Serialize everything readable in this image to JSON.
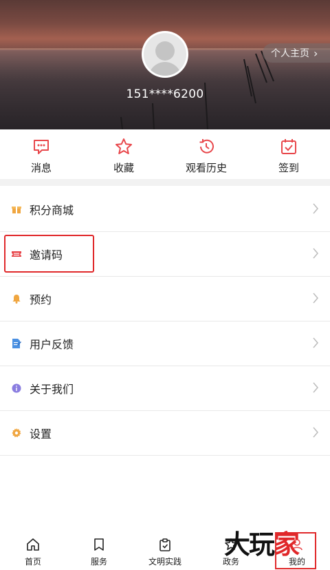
{
  "header": {
    "phone": "151****6200",
    "home_link": "个人主页"
  },
  "quick_actions": [
    {
      "label": "消息",
      "icon": "message-icon"
    },
    {
      "label": "收藏",
      "icon": "star-icon"
    },
    {
      "label": "观看历史",
      "icon": "history-icon"
    },
    {
      "label": "签到",
      "icon": "calendar-check-icon"
    }
  ],
  "menu": [
    {
      "label": "积分商城",
      "icon": "gift-icon",
      "color": "#f0a640"
    },
    {
      "label": "邀请码",
      "icon": "ticket-icon",
      "color": "#e8474b"
    },
    {
      "label": "预约",
      "icon": "bell-icon",
      "color": "#f0a640"
    },
    {
      "label": "用户反馈",
      "icon": "feedback-icon",
      "color": "#4a90e2"
    },
    {
      "label": "关于我们",
      "icon": "info-icon",
      "color": "#8a7de0"
    },
    {
      "label": "设置",
      "icon": "gear-icon",
      "color": "#f0a640"
    }
  ],
  "tabbar": [
    {
      "label": "首页",
      "icon": "home-icon"
    },
    {
      "label": "服务",
      "icon": "bookmark-icon"
    },
    {
      "label": "文明实践",
      "icon": "clipboard-icon"
    },
    {
      "label": "政务",
      "icon": "star-outline-icon"
    },
    {
      "label": "我的",
      "icon": "user-icon"
    }
  ],
  "watermark": {
    "part1": "大玩",
    "part2": "家"
  },
  "colors": {
    "accent": "#e8474b",
    "highlight": "#e0282a"
  }
}
